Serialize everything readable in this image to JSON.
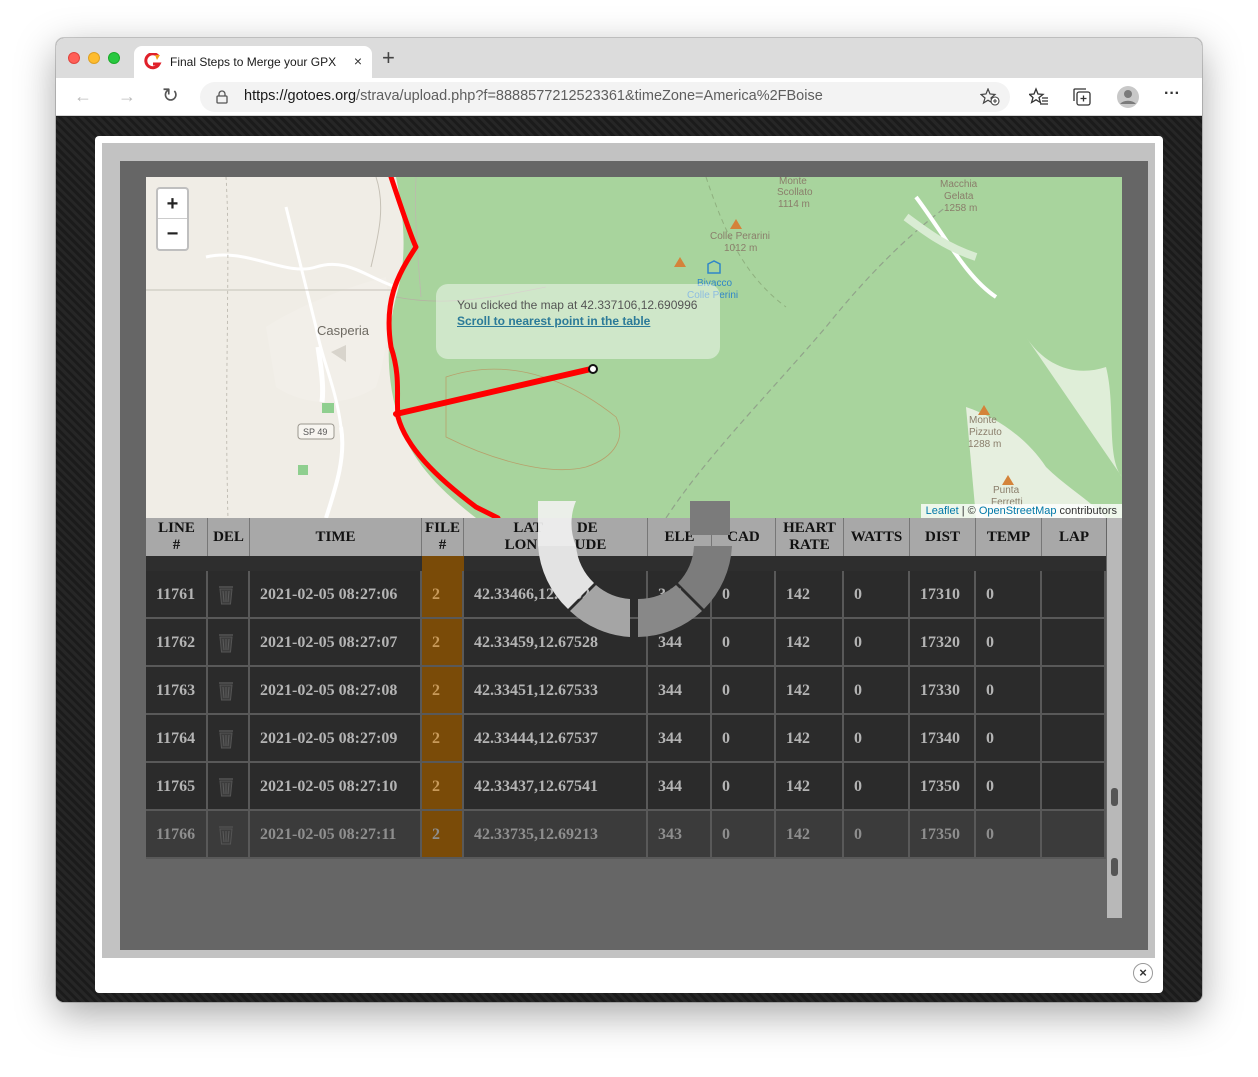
{
  "browser": {
    "tab_title": "Final Steps to Merge your GPX",
    "tab_close": "×",
    "new_tab": "+",
    "url_domain": "https://gotoes.org",
    "url_path": "/strava/upload.php?f=8888577212523361&timeZone=America%2FBoise",
    "back": "←",
    "forward": "→",
    "reload": "↻",
    "menu": "···"
  },
  "map": {
    "zoom_in": "+",
    "zoom_out": "−",
    "popup_text": "You clicked the map at 42.337106,12.690996",
    "popup_link": "Scroll to nearest point in the table",
    "labels": {
      "casperia": "Casperia",
      "sp49": "SP 49",
      "monte_scollato": [
        "Monte",
        "Scollato",
        "1114 m"
      ],
      "colle_perarini": [
        "Colle Perarini",
        "1012 m"
      ],
      "bivacco": [
        "Bivacco",
        "Colle Perini"
      ],
      "macchia_gelata": [
        "Macchia",
        "Gelata",
        "1258 m"
      ],
      "monte_pizzuto": [
        "Monte",
        "Pizzuto",
        "1288 m"
      ],
      "punta_ferretti": [
        "Punta",
        "Ferretti"
      ]
    },
    "attribution": {
      "leaflet": "Leaflet",
      "separator": " | © ",
      "osm": "OpenStreetMap",
      "contributors": " contributors"
    }
  },
  "table": {
    "headers": [
      "LINE #",
      "DEL",
      "TIME",
      "FILE #",
      "LATITUDE LONGITUDE",
      "ELE",
      "CAD",
      "HEART RATE",
      "WATTS",
      "DIST",
      "TEMP",
      "LAP"
    ],
    "header_display": {
      "line": [
        "LINE",
        "#"
      ],
      "del": "DEL",
      "time": "TIME",
      "file": [
        "FILE",
        "#"
      ],
      "latlon": [
        "LAT",
        "DE",
        "LON",
        "UDE"
      ],
      "ele": "ELE",
      "cad": "CAD",
      "hr": [
        "HEART",
        "RATE"
      ],
      "watts": "WATTS",
      "dist": "DIST",
      "temp": "TEMP",
      "lap": "LAP"
    },
    "rows": [
      {
        "line": "11761",
        "time": "2021-02-05 08:27:06",
        "file": "2",
        "latlon": "42.33466,12.67524",
        "latlon_visible": "42.33466,1",
        "latlon_tail": "4",
        "ele": "344",
        "ele_visible": "34",
        "cad": "0",
        "hr": "142",
        "watts": "0",
        "dist": "17310",
        "temp": "0",
        "lap": ""
      },
      {
        "line": "11762",
        "time": "2021-02-05 08:27:07",
        "file": "2",
        "latlon": "42.33459,12.67528",
        "latlon_visible": "42.33459,12.6752",
        "ele": "344",
        "ele_visible": "44",
        "cad": "0",
        "hr": "142",
        "watts": "0",
        "dist": "17320",
        "temp": "0",
        "lap": ""
      },
      {
        "line": "11763",
        "time": "2021-02-05 08:27:08",
        "file": "2",
        "latlon": "42.33451,12.67533",
        "ele": "344",
        "cad": "0",
        "hr": "142",
        "watts": "0",
        "dist": "17330",
        "temp": "0",
        "lap": ""
      },
      {
        "line": "11764",
        "time": "2021-02-05 08:27:09",
        "file": "2",
        "latlon": "42.33444,12.67537",
        "ele": "344",
        "cad": "0",
        "hr": "142",
        "watts": "0",
        "dist": "17340",
        "temp": "0",
        "lap": ""
      },
      {
        "line": "11765",
        "time": "2021-02-05 08:27:10",
        "file": "2",
        "latlon": "42.33437,12.67541",
        "ele": "344",
        "cad": "0",
        "hr": "142",
        "watts": "0",
        "dist": "17350",
        "temp": "0",
        "lap": ""
      },
      {
        "line": "11766",
        "time": "2021-02-05 08:27:11",
        "file": "2",
        "latlon": "42.33735,12.69213",
        "ele": "343",
        "cad": "0",
        "hr": "142",
        "watts": "0",
        "dist": "17350",
        "temp": "0",
        "lap": ""
      }
    ]
  },
  "modal_close": "×",
  "colors": {
    "route": "#ff0000",
    "map_green": "#a8d49d",
    "file_column": "#7a4b08"
  }
}
